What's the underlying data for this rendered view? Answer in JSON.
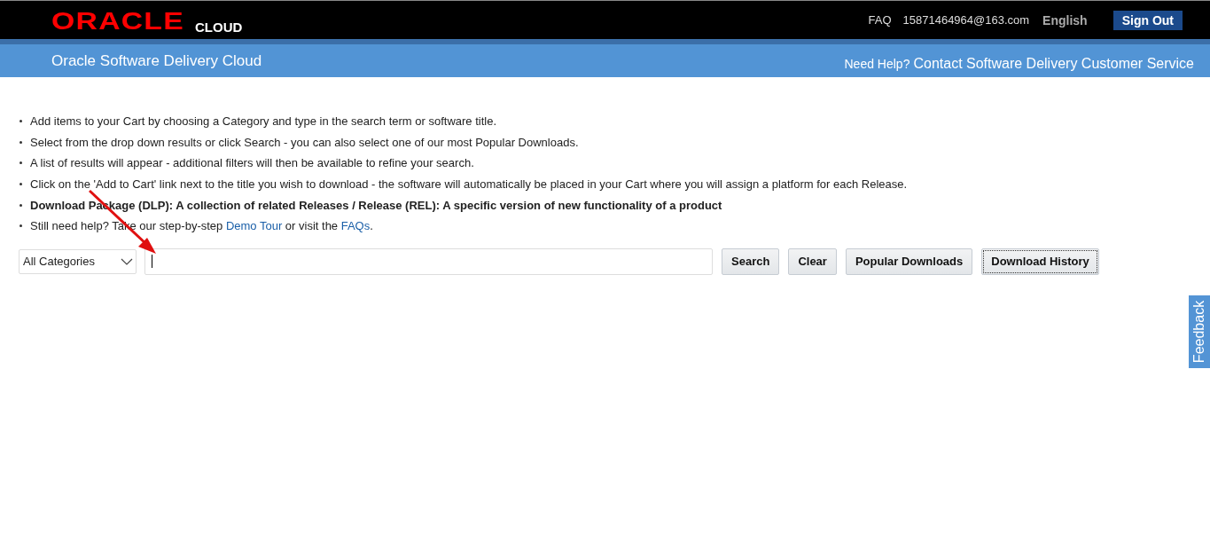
{
  "header": {
    "logo": {
      "brand": "ORACLE",
      "sub": "CLOUD"
    },
    "links": [
      {
        "kind": "link",
        "label": "FAQ"
      },
      {
        "kind": "link",
        "label": "15871464964@163.com"
      },
      {
        "kind": "language",
        "label": "English"
      },
      {
        "kind": "button",
        "label": "Sign Out"
      }
    ]
  },
  "banner": {
    "title": "Oracle Software Delivery Cloud",
    "help_prefix": "Need Help?",
    "help_link": "Contact Software Delivery Customer Service"
  },
  "instructions": [
    {
      "bold": false,
      "parts": [
        {
          "kind": "text",
          "text": "Add items to your Cart by choosing a Category and type in the search term or software title."
        }
      ]
    },
    {
      "bold": false,
      "parts": [
        {
          "kind": "text",
          "text": "Select from the drop down results or click Search - you can also select one of our most Popular Downloads."
        }
      ]
    },
    {
      "bold": false,
      "parts": [
        {
          "kind": "text",
          "text": "A list of results will appear - additional filters will then be available to refine your search."
        }
      ]
    },
    {
      "bold": false,
      "parts": [
        {
          "kind": "text",
          "text": "Click on the 'Add to Cart' link next to the title you wish to download - the software will automatically be placed in your Cart where you will assign a platform for each Release."
        }
      ]
    },
    {
      "bold": true,
      "parts": [
        {
          "kind": "text",
          "text": "Download Package (DLP): A collection of related Releases / Release (REL): A specific version of new functionality of a product"
        }
      ]
    },
    {
      "bold": false,
      "parts": [
        {
          "kind": "text",
          "text": "Still need help? Take our step-by-step "
        },
        {
          "kind": "link",
          "text": "Demo Tour"
        },
        {
          "kind": "text",
          "text": " or visit the "
        },
        {
          "kind": "link",
          "text": "FAQs"
        },
        {
          "kind": "text",
          "text": "."
        }
      ]
    }
  ],
  "search": {
    "category": "All Categories",
    "query_focused": true,
    "buttons": [
      {
        "label": "Search",
        "focused": false
      },
      {
        "label": "Clear",
        "focused": false
      },
      {
        "label": "Popular Downloads",
        "focused": false
      },
      {
        "label": "Download History",
        "focused": true
      }
    ]
  },
  "feedback_tab": {
    "label": "Feedback"
  }
}
